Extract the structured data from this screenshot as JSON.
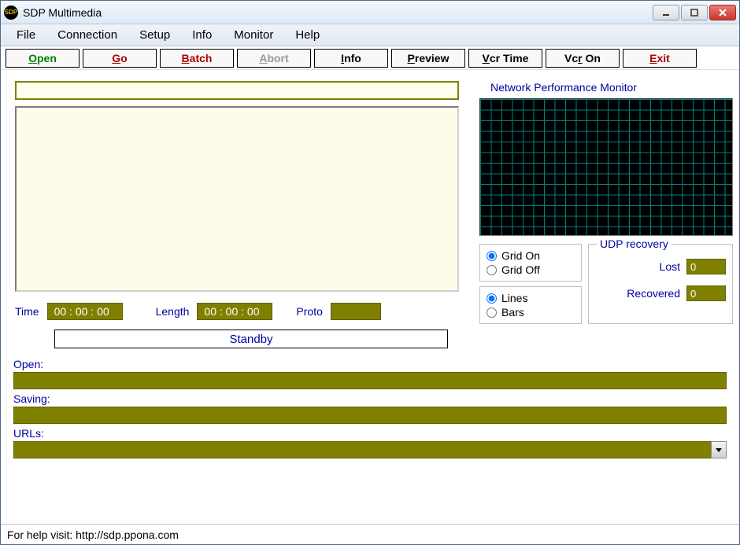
{
  "window": {
    "title": "SDP Multimedia"
  },
  "menu": {
    "items": [
      "File",
      "Connection",
      "Setup",
      "Info",
      "Monitor",
      "Help"
    ]
  },
  "toolbar": {
    "open": "Open",
    "go": "Go",
    "batch": "Batch",
    "abort": "Abort",
    "info": "Info",
    "preview": "Preview",
    "vcrtime": "Vcr Time",
    "vcron": "Vcr On",
    "exit": "Exit"
  },
  "main": {
    "time_label": "Time",
    "time_value": "00 : 00 : 00",
    "length_label": "Length",
    "length_value": "00 : 00 : 00",
    "proto_label": "Proto",
    "proto_value": "",
    "status": "Standby"
  },
  "monitor": {
    "title": "Network Performance Monitor",
    "grid_on": "Grid On",
    "grid_off": "Grid Off",
    "lines": "Lines",
    "bars": "Bars",
    "udp_title": "UDP recovery",
    "lost_label": "Lost",
    "lost_value": "0",
    "recovered_label": "Recovered",
    "recovered_value": "0"
  },
  "bottom": {
    "open_label": "Open:",
    "open_value": "",
    "saving_label": "Saving:",
    "saving_value": "",
    "urls_label": "URLs:",
    "urls_value": ""
  },
  "statusbar": {
    "text": "For help visit: http://sdp.ppona.com"
  }
}
